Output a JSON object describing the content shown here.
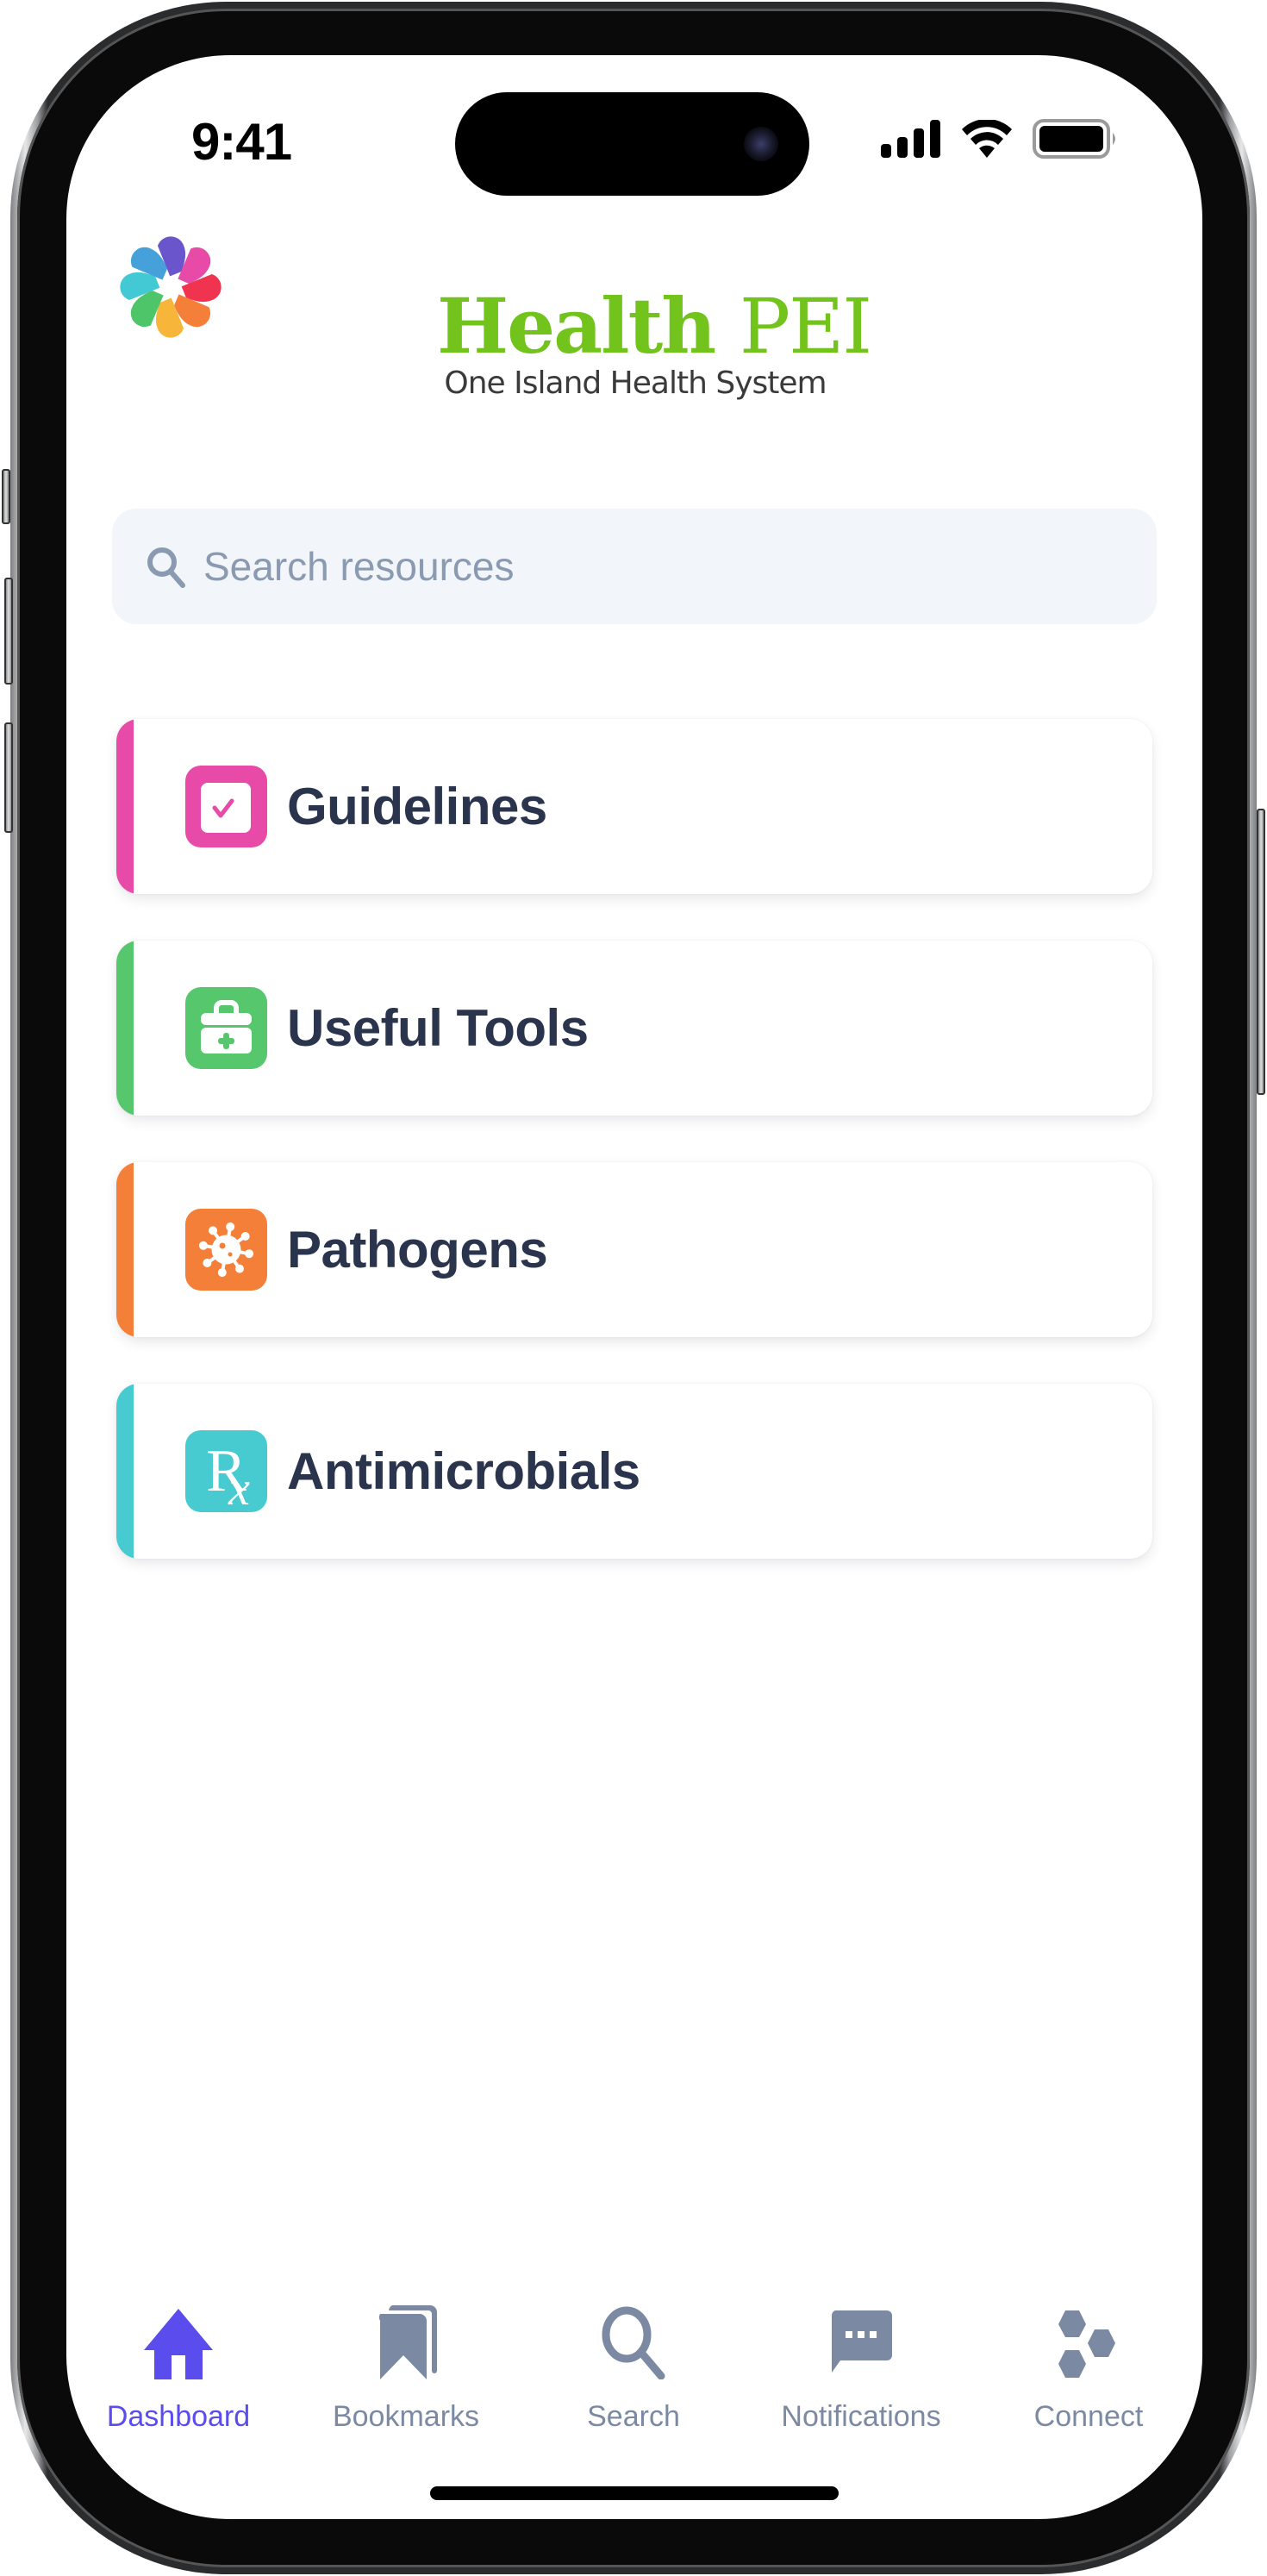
{
  "status_bar": {
    "time": "9:41",
    "signal_icon": "cellular-signal-icon",
    "wifi_icon": "wifi-icon",
    "battery_icon": "battery-full-icon"
  },
  "header": {
    "logo_icon": "health-pei-flower-logo",
    "brand_title_bold": "Health",
    "brand_title_light": "PEI",
    "brand_subtitle": "One Island Health System",
    "colors": {
      "brand_green": "#72c31b",
      "petals": [
        "#6a55cc",
        "#e84aa8",
        "#f0344f",
        "#f47f38",
        "#f7b63a",
        "#4fc56a",
        "#43c9d3",
        "#46a0d9"
      ]
    }
  },
  "search": {
    "placeholder": "Search resources",
    "value": "",
    "icon": "search-icon"
  },
  "categories": [
    {
      "label": "Guidelines",
      "icon": "checklist-icon",
      "color": "#e84aa8"
    },
    {
      "label": "Useful Tools",
      "icon": "medical-kit-icon",
      "color": "#57c76d"
    },
    {
      "label": "Pathogens",
      "icon": "virus-icon",
      "color": "#f47f38"
    },
    {
      "label": "Antimicrobials",
      "icon": "rx-prescription-icon",
      "color": "#47cbd0",
      "icon_text": "R",
      "icon_subtext": "x"
    }
  ],
  "tabbar": {
    "active_color": "#5b4ded",
    "inactive_color": "#7b8aa2",
    "tabs": [
      {
        "label": "Dashboard",
        "icon": "home-icon",
        "active": true
      },
      {
        "label": "Bookmarks",
        "icon": "bookmarks-icon",
        "active": false
      },
      {
        "label": "Search",
        "icon": "search-icon",
        "active": false
      },
      {
        "label": "Notifications",
        "icon": "chat-bubble-icon",
        "active": false
      },
      {
        "label": "Connect",
        "icon": "hexagons-icon",
        "active": false
      }
    ]
  }
}
